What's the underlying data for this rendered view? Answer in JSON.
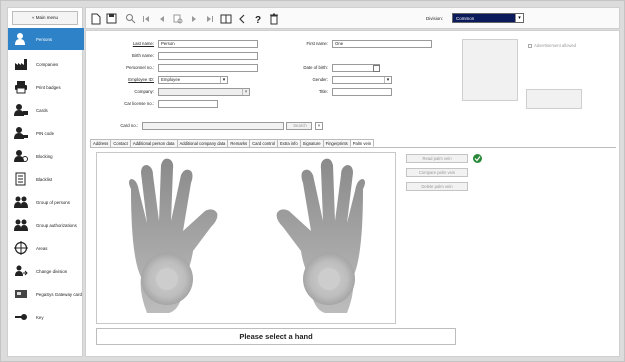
{
  "sidebar": {
    "main_menu": "« Main menu",
    "items": [
      {
        "label": "Persons",
        "icon": "person-icon"
      },
      {
        "label": "Companies",
        "icon": "factory-icon"
      },
      {
        "label": "Print badges",
        "icon": "printer-icon"
      },
      {
        "label": "Cards",
        "icon": "card-person-icon"
      },
      {
        "label": "PIN code",
        "icon": "pin-person-icon"
      },
      {
        "label": "Blocking",
        "icon": "block-person-icon"
      },
      {
        "label": "Blacklist",
        "icon": "blacklist-icon"
      },
      {
        "label": "Group of persons",
        "icon": "group-icon"
      },
      {
        "label": "Group authorizations",
        "icon": "group-auth-icon"
      },
      {
        "label": "Areas",
        "icon": "areas-icon"
      },
      {
        "label": "Change division",
        "icon": "change-division-icon"
      },
      {
        "label": "PegaSys Gateway card",
        "icon": "gateway-card-icon"
      },
      {
        "label": "Key",
        "icon": "key-icon"
      }
    ]
  },
  "toolbar": {
    "division_label": "Division:",
    "division_value": "Common"
  },
  "form": {
    "last_name_label": "Last name:",
    "last_name_value": "Person",
    "first_name_label": "First name:",
    "first_name_value": "One",
    "birth_name_label": "Birth name:",
    "personnel_no_label": "Personnel no.:",
    "date_of_birth_label": "Date of birth:",
    "employee_id_label": "Employee ID:",
    "employee_id_value": "Employee",
    "gender_label": "Gender:",
    "company_label": "Company:",
    "title_label": "Title:",
    "car_license_label": "Car license no.:",
    "card_no_label": "Card no.:",
    "search_button": "Search",
    "advertisement_label": "Advertisement allowed"
  },
  "tabs": [
    "Address",
    "Contact",
    "Additional person data",
    "Additional company data",
    "Remarks",
    "Card control",
    "Extra info",
    "Signature",
    "Fingerprints",
    "Palm vein"
  ],
  "active_tab": "Palm vein",
  "palm_panel": {
    "read_button": "Read palm vein",
    "compare_button": "Compare palm vein",
    "delete_button": "Delete palm vein",
    "status_text": "Please select a hand"
  }
}
